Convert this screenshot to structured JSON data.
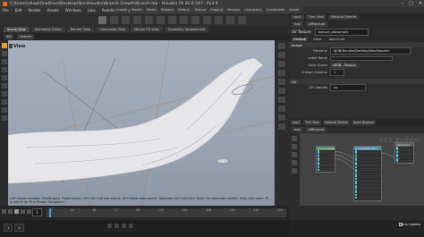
{
  "window": {
    "title": "C:\\Users\\shaw\\OneDrive\\Desktop\\Skin\\Houdini\\Branch Growth\\Branch.hip - Houdini FX 20.0.547 - Py3.9",
    "controls": [
      "–",
      "□",
      "✕"
    ]
  },
  "menu": [
    "File",
    "Edit",
    "Render",
    "Assets",
    "Windows",
    "Labs",
    "Redshift",
    "Help"
  ],
  "shelf_tabs": [
    "Create",
    "Modify",
    "Model",
    "Polygon",
    "Deform",
    "Texture",
    "Rigging",
    "Muscles",
    "Characters",
    "Constraints",
    "Guide"
  ],
  "scene_tabs": [
    "Scene View",
    "Animation Editor",
    "Render View",
    "Composite View",
    "Motion FX View",
    "Geometry Spreadsheet"
  ],
  "path": {
    "network": "obj",
    "node": "branch"
  },
  "viewport": {
    "label": "View",
    "hint": "Left mouse tumbles. Middle pans. Right dollies. Ctrl+Alt+Left box-zooms. Ctrl+Right-drag zooms. Spacebar-Ctrl+Left tilts. Hold L for alternate tumble, dolly, and zoom. M or Alt+M for First Person Navigation."
  },
  "parameters": {
    "tabs": [
      "vop1",
      "Tree View",
      "Material Palette"
    ],
    "path": {
      "network": "mat",
      "node": "difftexture"
    },
    "node_type": "UV Texture",
    "node_name": "texture_aNowmat1",
    "subtabs": [
      "General",
      "Node",
      "Advanced"
    ],
    "section": "Image",
    "rows": [
      {
        "label": "Filename",
        "value": "$JOB/Houdini/Desktop/Skin/Houdini"
      },
      {
        "label": "Label Name",
        "value": ""
      },
      {
        "label": "Color Space",
        "value": "sRGB - Texture"
      },
      {
        "label": "Custom Gamma",
        "value": "1"
      }
    ],
    "section2": "UV",
    "rows2": [
      {
        "label": "UV Channel",
        "value": "uv"
      }
    ]
  },
  "network": {
    "tabs": [
      "vop1",
      "Tree View",
      "Material Palette",
      "Asset Browser"
    ],
    "path": {
      "network": "mat",
      "node": "difftexture"
    },
    "builder_label": "VEX Builder",
    "nodes": [
      {
        "name": "surfaceOutput1"
      },
      {
        "name": "principledshader1"
      },
      {
        "name": "uvtexture1"
      }
    ]
  },
  "timeline": {
    "frame": "1",
    "ticks": [
      "1",
      "24",
      "48",
      "72",
      "96",
      "120",
      "144",
      "168",
      "192",
      "216",
      "240"
    ]
  },
  "bottom": {
    "range": [
      "1",
      "1",
      "240",
      "240"
    ],
    "auto_update": "Auto Update"
  }
}
